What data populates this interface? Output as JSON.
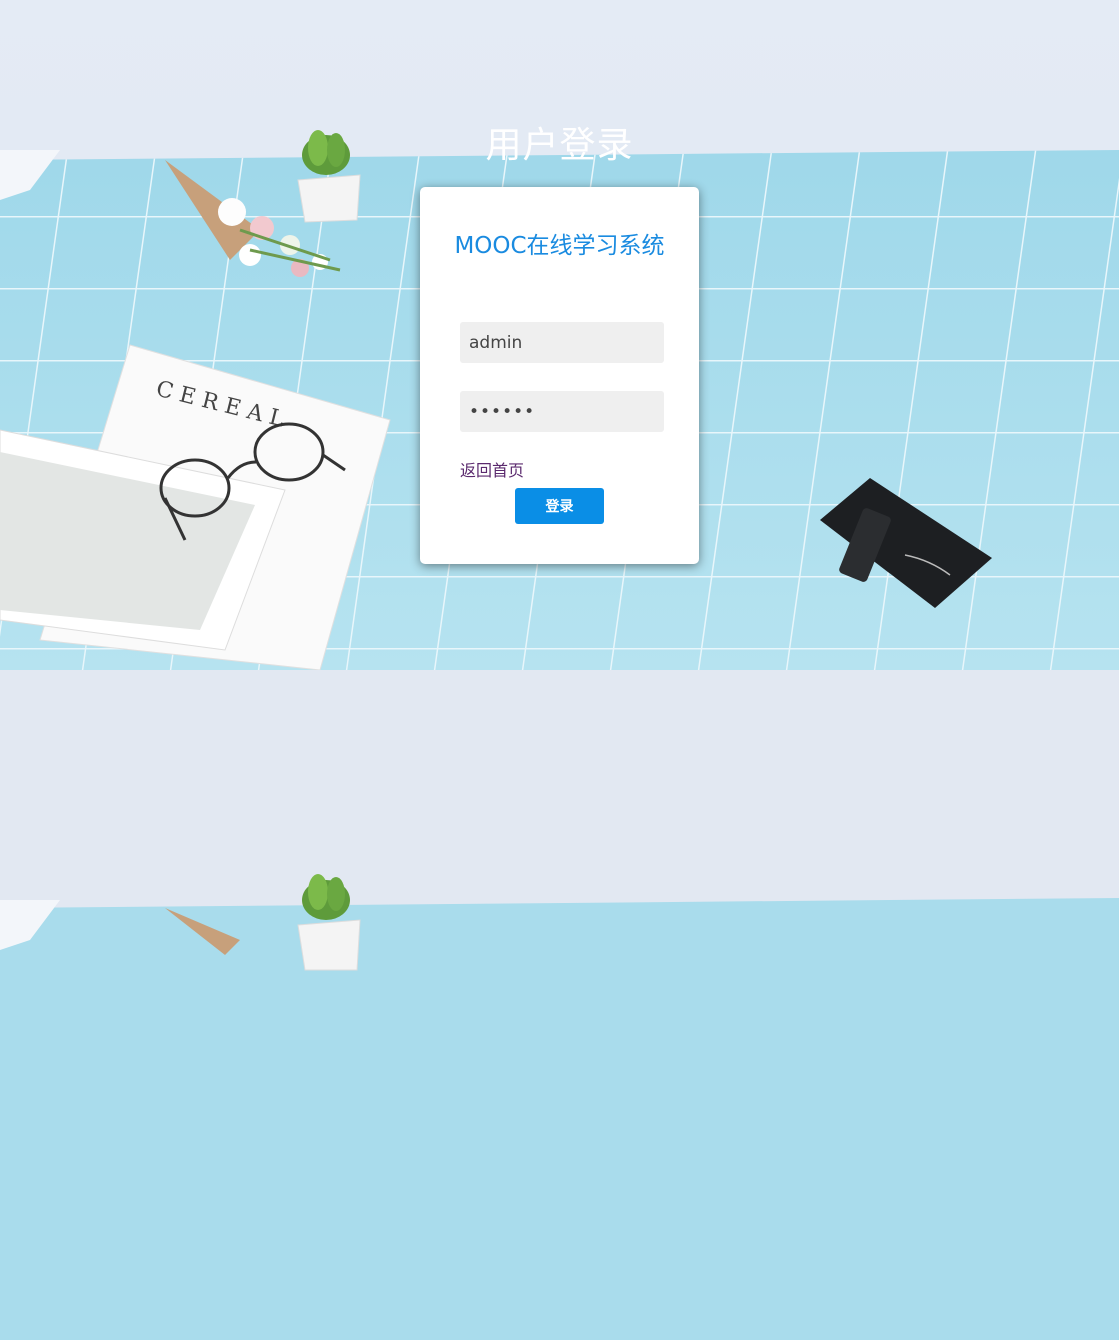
{
  "page": {
    "heading": "用户登录"
  },
  "login_card": {
    "system_name": "MOOC在线学习系统",
    "username_value": "admin",
    "password_value": "••••••",
    "back_link": "返回首页",
    "login_button": "登录"
  },
  "colors": {
    "system_name": "#1a8be0",
    "button": "#0a8ee6",
    "back_link": "#5b2a6e",
    "tablecloth": "#a9dcec",
    "wall": "#e6ecf5"
  }
}
